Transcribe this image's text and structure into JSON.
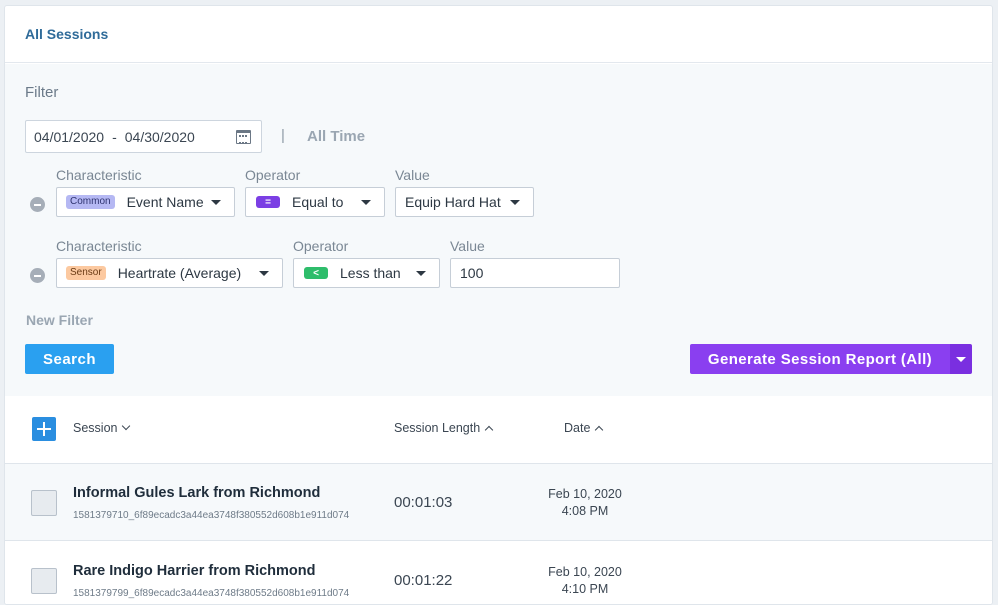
{
  "header": {
    "title": "All Sessions"
  },
  "filter": {
    "label": "Filter",
    "date_range": {
      "start": "04/01/2020",
      "separator": "-",
      "end": "04/30/2020"
    },
    "pipe": "|",
    "all_time": "All Time",
    "rows": [
      {
        "characteristic_label": "Characteristic",
        "operator_label": "Operator",
        "value_label": "Value",
        "badge": "Common",
        "characteristic": "Event Name",
        "operator_symbol": "=",
        "operator": "Equal to",
        "value": "Equip Hard Hat"
      },
      {
        "characteristic_label": "Characteristic",
        "operator_label": "Operator",
        "value_label": "Value",
        "badge": "Sensor",
        "characteristic": "Heartrate (Average)",
        "operator_symbol": "<",
        "operator": "Less than",
        "value": "100"
      }
    ],
    "new_filter": "New Filter",
    "search_label": "Search",
    "report_label": "Generate Session Report (All)"
  },
  "table": {
    "columns": {
      "session": "Session",
      "length": "Session Length",
      "date": "Date"
    },
    "rows": [
      {
        "name": "Informal Gules Lark from Richmond",
        "id": "1581379710_6f89ecadc3a44ea3748f380552d608b1e911d074",
        "length": "00:01:03",
        "date": "Feb 10, 2020",
        "time": "4:08 PM"
      },
      {
        "name": "Rare Indigo Harrier from Richmond",
        "id": "1581379799_6f89ecadc3a44ea3748f380552d608b1e911d074",
        "length": "00:01:22",
        "date": "Feb 10, 2020",
        "time": "4:10 PM"
      }
    ]
  },
  "colors": {
    "accent_blue": "#2aa0f0",
    "report_purple": "#8a3ff0",
    "title_blue": "#2f6b99"
  }
}
